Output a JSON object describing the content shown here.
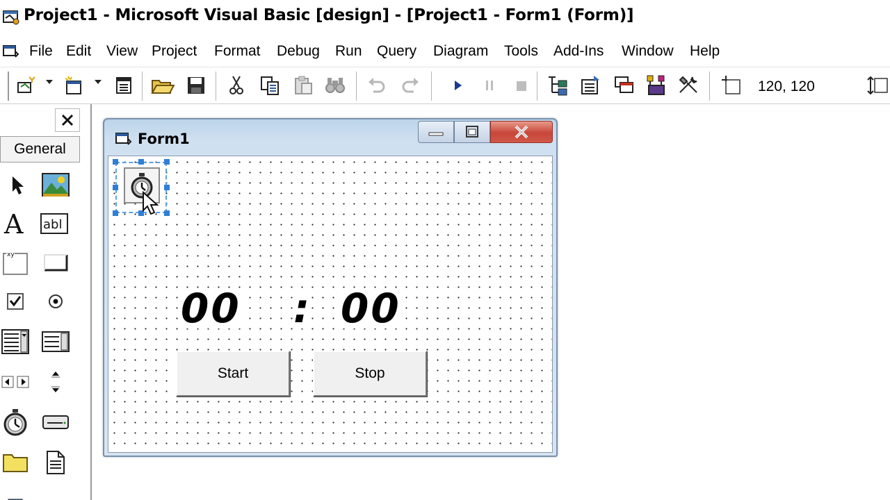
{
  "window": {
    "title": "Project1 - Microsoft Visual Basic [design] - [Project1 - Form1 (Form)]"
  },
  "menu": [
    "File",
    "Edit",
    "View",
    "Project",
    "Format",
    "Debug",
    "Run",
    "Query",
    "Diagram",
    "Tools",
    "Add-Ins",
    "Window",
    "Help"
  ],
  "toolbar": {
    "coordinates": "120, 120",
    "icons": [
      "add-project-icon",
      "add-form-icon",
      "menu-editor-icon",
      "open-icon",
      "save-icon",
      "cut-icon",
      "copy-icon",
      "paste-icon",
      "find-icon",
      "undo-icon",
      "redo-icon",
      "start-icon",
      "break-icon",
      "end-icon",
      "project-explorer-icon",
      "properties-window-icon",
      "form-layout-icon",
      "object-browser-icon",
      "toolbox-icon",
      "position-icon",
      "size-icon"
    ]
  },
  "toolbox": {
    "tab_label": "General",
    "tools": [
      "pointer-icon",
      "picturebox-icon",
      "label-icon",
      "textbox-icon",
      "frame-icon",
      "commandbutton-icon",
      "checkbox-icon",
      "optionbutton-icon",
      "combobox-icon",
      "listbox-icon",
      "hscrollbar-icon",
      "vscrollbar-icon",
      "timer-icon",
      "drivelistbox-icon",
      "dirlistbox-icon",
      "filelistbox-icon"
    ]
  },
  "form": {
    "title": "Form1",
    "minutes": "00",
    "separator": ":",
    "seconds": "00",
    "start_button": "Start",
    "stop_button": "Stop"
  },
  "colors": {
    "form_caption_gradient": "#bcd4ea",
    "close_button": "#c8463a",
    "selection_handles": "#2f7fd6"
  }
}
